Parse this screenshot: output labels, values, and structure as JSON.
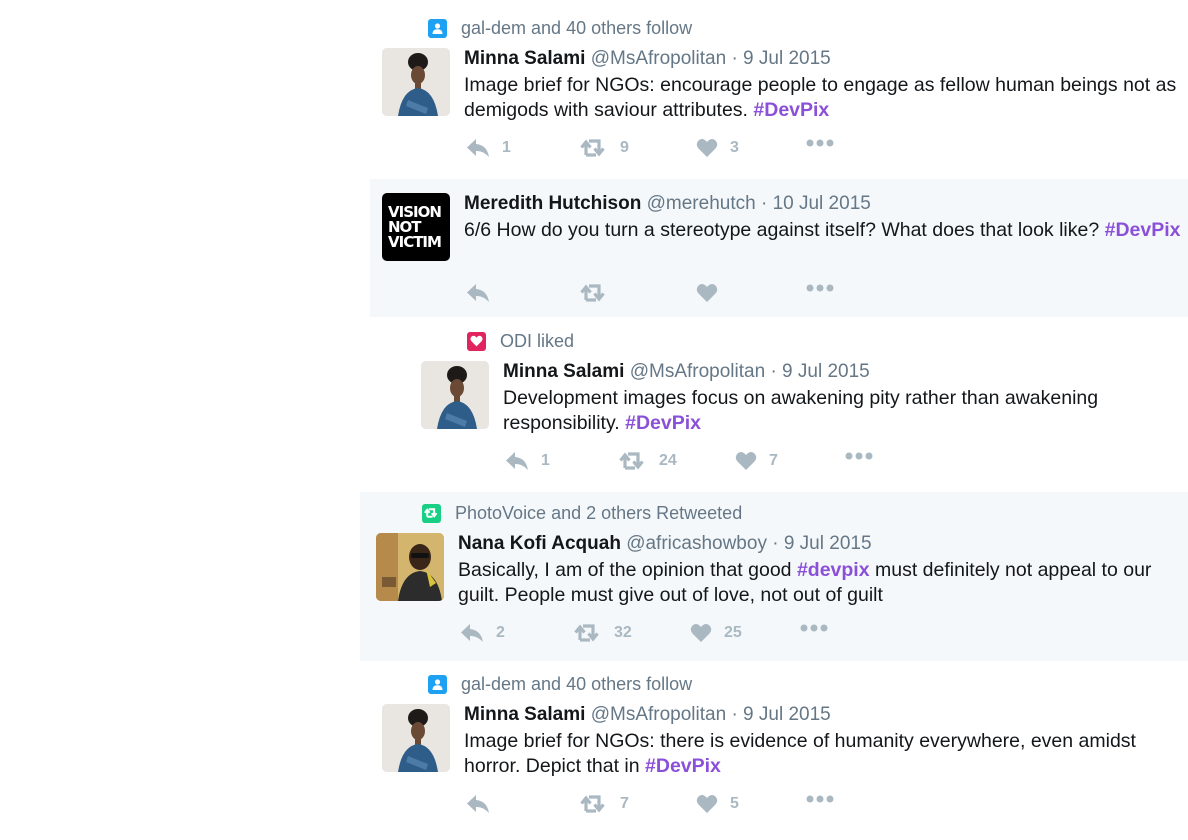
{
  "tweets": [
    {
      "context": "gal-dem and 40 others follow",
      "context_type": "follow",
      "name": "Minna Salami",
      "handle": "@MsAfropolitan",
      "date": "· 9 Jul 2015",
      "text": "Image brief for NGOs: encourage people to engage as fellow human beings not as demigods with saviour attributes.",
      "hashtag": "#DevPix",
      "after": "",
      "replies": "1",
      "retweets": "9",
      "likes": "3"
    },
    {
      "context": "",
      "name": "Meredith Hutchison",
      "handle": "@merehutch",
      "date": "· 10 Jul 2015",
      "text": "6/6 How do you turn a stereotype against itself? What does that look like?",
      "hashtag": "#DevPix",
      "after": "",
      "avatar_text": [
        "VISION",
        "NOT",
        "VICTIM"
      ],
      "replies": "",
      "retweets": "",
      "likes": ""
    },
    {
      "context": "ODI liked",
      "context_type": "like",
      "name": "Minna Salami",
      "handle": "@MsAfropolitan",
      "date": "· 9 Jul 2015",
      "text": "Development images focus on awakening pity rather than awakening responsibility.",
      "hashtag": "#DevPix",
      "after": "",
      "replies": "1",
      "retweets": "24",
      "likes": "7"
    },
    {
      "context": "PhotoVoice and 2 others Retweeted",
      "context_type": "retweet",
      "name": "Nana Kofi Acquah",
      "handle": "@africashowboy",
      "date": "· 9 Jul 2015",
      "text": "Basically, I am of the opinion that good",
      "hashtag": "#devpix",
      "after": "must definitely not appeal to our guilt. People must give out of love, not out of guilt",
      "replies": "2",
      "retweets": "32",
      "likes": "25"
    },
    {
      "context": "gal-dem and 40 others follow",
      "context_type": "follow",
      "name": "Minna Salami",
      "handle": "@MsAfropolitan",
      "date": "· 9 Jul 2015",
      "text": "Image brief for NGOs: there is evidence of humanity everywhere, even amidst horror. Depict that in",
      "hashtag": "#DevPix",
      "after": "",
      "replies": "",
      "retweets": "7",
      "likes": "5"
    }
  ],
  "icons": {
    "follow": "person-icon",
    "like": "heart-icon",
    "retweet": "retweet-icon",
    "reply": "reply-icon",
    "more": "more-dots-icon"
  },
  "colors": {
    "hashtag": "#8b50d8",
    "follow_badge": "#1da1f2",
    "like_badge": "#e0245e",
    "retweet_badge": "#19cf86",
    "band": "#f5f8fa"
  }
}
